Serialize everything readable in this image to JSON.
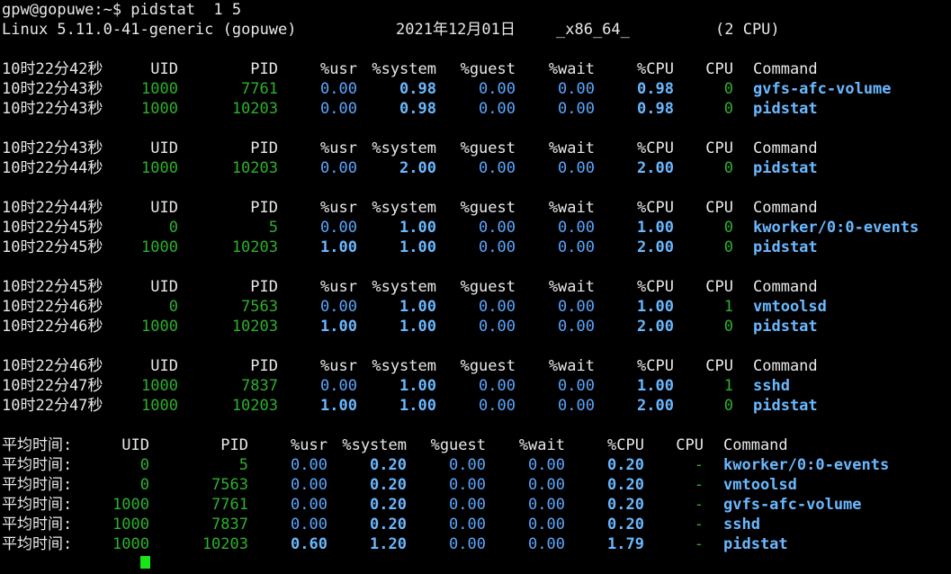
{
  "prompt": "gpw@gopuwe:~$ pidstat  1 5",
  "sysinfo": {
    "kernel": "Linux 5.11.0-41-generic (gopuwe)",
    "date": "2021年12月01日",
    "arch": "_x86_64_",
    "cpus": "(2 CPU)"
  },
  "columns": {
    "uid": "UID",
    "pid": "PID",
    "usr": "%usr",
    "system": "%system",
    "guest": "%guest",
    "wait": "%wait",
    "cpu_pct": "%CPU",
    "cpu": "CPU",
    "command": "Command"
  },
  "blocks": [
    {
      "header_time": "10时22分42秒",
      "rows": [
        {
          "time": "10时22分43秒",
          "uid": "1000",
          "pid": "7761",
          "usr": "0.00",
          "system": "0.98",
          "guest": "0.00",
          "wait": "0.00",
          "cpu_pct": "0.98",
          "cpu": "0",
          "command": "gvfs-afc-volume"
        },
        {
          "time": "10时22分43秒",
          "uid": "1000",
          "pid": "10203",
          "usr": "0.00",
          "system": "0.98",
          "guest": "0.00",
          "wait": "0.00",
          "cpu_pct": "0.98",
          "cpu": "0",
          "command": "pidstat"
        }
      ]
    },
    {
      "header_time": "10时22分43秒",
      "rows": [
        {
          "time": "10时22分44秒",
          "uid": "1000",
          "pid": "10203",
          "usr": "0.00",
          "system": "2.00",
          "guest": "0.00",
          "wait": "0.00",
          "cpu_pct": "2.00",
          "cpu": "0",
          "command": "pidstat"
        }
      ]
    },
    {
      "header_time": "10时22分44秒",
      "rows": [
        {
          "time": "10时22分45秒",
          "uid": "0",
          "pid": "5",
          "usr": "0.00",
          "system": "1.00",
          "guest": "0.00",
          "wait": "0.00",
          "cpu_pct": "1.00",
          "cpu": "0",
          "command": "kworker/0:0-events"
        },
        {
          "time": "10时22分45秒",
          "uid": "1000",
          "pid": "10203",
          "usr": "1.00",
          "system": "1.00",
          "guest": "0.00",
          "wait": "0.00",
          "cpu_pct": "2.00",
          "cpu": "0",
          "command": "pidstat"
        }
      ]
    },
    {
      "header_time": "10时22分45秒",
      "rows": [
        {
          "time": "10时22分46秒",
          "uid": "0",
          "pid": "7563",
          "usr": "0.00",
          "system": "1.00",
          "guest": "0.00",
          "wait": "0.00",
          "cpu_pct": "1.00",
          "cpu": "1",
          "command": "vmtoolsd"
        },
        {
          "time": "10时22分46秒",
          "uid": "1000",
          "pid": "10203",
          "usr": "1.00",
          "system": "1.00",
          "guest": "0.00",
          "wait": "0.00",
          "cpu_pct": "2.00",
          "cpu": "0",
          "command": "pidstat"
        }
      ]
    },
    {
      "header_time": "10时22分46秒",
      "rows": [
        {
          "time": "10时22分47秒",
          "uid": "1000",
          "pid": "7837",
          "usr": "0.00",
          "system": "1.00",
          "guest": "0.00",
          "wait": "0.00",
          "cpu_pct": "1.00",
          "cpu": "1",
          "command": "sshd"
        },
        {
          "time": "10时22分47秒",
          "uid": "1000",
          "pid": "10203",
          "usr": "1.00",
          "system": "1.00",
          "guest": "0.00",
          "wait": "0.00",
          "cpu_pct": "2.00",
          "cpu": "0",
          "command": "pidstat"
        }
      ]
    }
  ],
  "average": {
    "header_time": "平均时间:",
    "rows": [
      {
        "time": "平均时间:",
        "uid": "0",
        "pid": "5",
        "usr": "0.00",
        "system": "0.20",
        "guest": "0.00",
        "wait": "0.00",
        "cpu_pct": "0.20",
        "cpu": "-",
        "command": "kworker/0:0-events"
      },
      {
        "time": "平均时间:",
        "uid": "0",
        "pid": "7563",
        "usr": "0.00",
        "system": "0.20",
        "guest": "0.00",
        "wait": "0.00",
        "cpu_pct": "0.20",
        "cpu": "-",
        "command": "vmtoolsd"
      },
      {
        "time": "平均时间:",
        "uid": "1000",
        "pid": "7761",
        "usr": "0.00",
        "system": "0.20",
        "guest": "0.00",
        "wait": "0.00",
        "cpu_pct": "0.20",
        "cpu": "-",
        "command": "gvfs-afc-volume"
      },
      {
        "time": "平均时间:",
        "uid": "1000",
        "pid": "7837",
        "usr": "0.00",
        "system": "0.20",
        "guest": "0.00",
        "wait": "0.00",
        "cpu_pct": "0.20",
        "cpu": "-",
        "command": "sshd"
      },
      {
        "time": "平均时间:",
        "uid": "1000",
        "pid": "10203",
        "usr": "0.60",
        "system": "1.20",
        "guest": "0.00",
        "wait": "0.00",
        "cpu_pct": "1.79",
        "cpu": "-",
        "command": "pidstat"
      }
    ]
  },
  "colors": {
    "background": "#000000",
    "text": "#e8e8e8",
    "ids": "#2db02d",
    "values": "#5aa7ff",
    "command": "#6ab8ff",
    "cursor": "#19e619"
  }
}
